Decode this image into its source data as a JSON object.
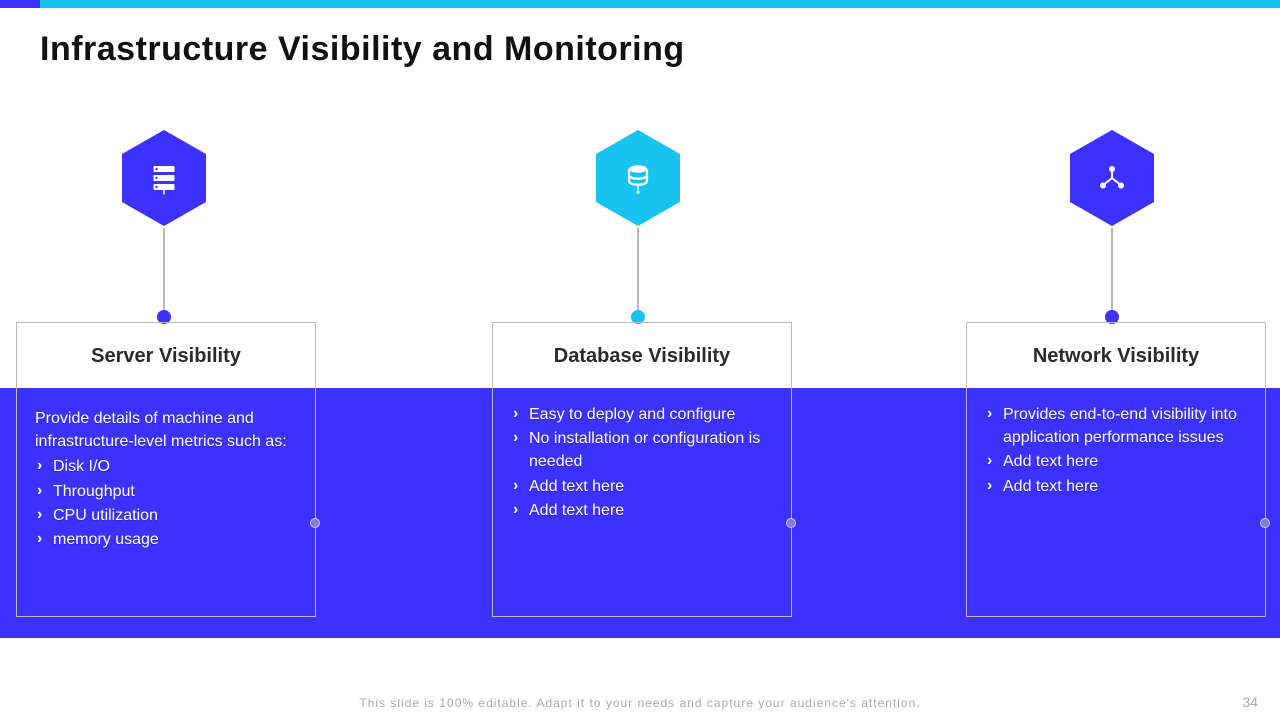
{
  "colors": {
    "primary": "#3b32ff",
    "accent": "#18c3ef"
  },
  "title": "Infrastructure Visibility and Monitoring",
  "columns": [
    {
      "heading": "Server Visibility",
      "icon": "server-icon",
      "color": "#3b32ff",
      "intro": "Provide details of  machine and infrastructure-level metrics such as:",
      "bullets": [
        "Disk I/O",
        "Throughput",
        "CPU utilization",
        "memory usage"
      ]
    },
    {
      "heading": "Database Visibility",
      "icon": "database-icon",
      "color": "#18c3ef",
      "intro": "",
      "bullets": [
        "Easy to deploy and configure",
        "No installation or configuration is needed",
        "Add text here",
        "Add text here"
      ]
    },
    {
      "heading": "Network Visibility",
      "icon": "network-icon",
      "color": "#3b32ff",
      "intro": "",
      "bullets": [
        "Provides end-to-end visibility into application performance issues",
        "Add text here",
        "Add text here"
      ]
    }
  ],
  "footer": "This slide is 100% editable. Adapt it to your needs and capture your audience's attention.",
  "page": "34"
}
